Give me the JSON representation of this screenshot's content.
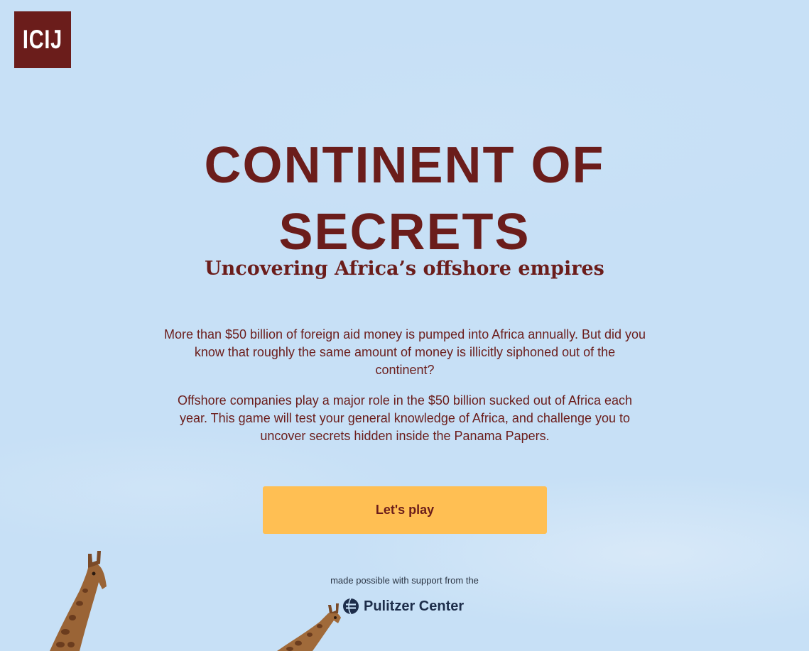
{
  "header": {
    "logo_text": "ICIJ"
  },
  "hero": {
    "title_line1": "CONTINENT OF",
    "title_line2": "SECRETS",
    "subtitle": "Uncovering Africa’s offshore empires"
  },
  "intro": {
    "paragraph1": "More than $50 billion of foreign aid money is pumped into Africa annually. But did you know that roughly the same amount of money is illicitly siphoned out of the continent?",
    "paragraph2": "Offshore companies play a major role in the $50 billion sucked out of Africa each year. This game will test your general knowledge of Africa, and challenge you to uncover secrets hidden inside the Panama Papers."
  },
  "actions": {
    "play_label": "Let's play"
  },
  "footer": {
    "support_text": "made possible with support from the",
    "sponsor_name": "Pulitzer Center",
    "sponsor_icon": "pulitzer-globe-icon"
  },
  "colors": {
    "background_sky": "#c7e0f6",
    "brand_maroon": "#6b1d1b",
    "button_yellow": "#ffbf53",
    "sponsor_navy": "#1d2d4a"
  }
}
